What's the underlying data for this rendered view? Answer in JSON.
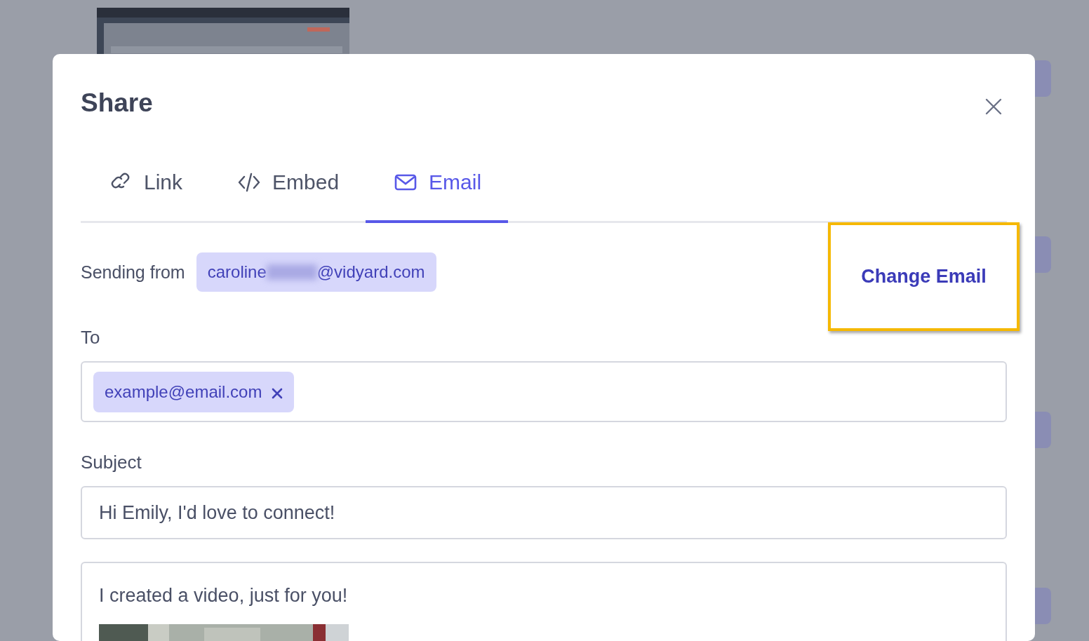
{
  "dialog": {
    "title": "Share"
  },
  "tabs": [
    {
      "label": "Link",
      "selected": false
    },
    {
      "label": "Embed",
      "selected": false
    },
    {
      "label": "Email",
      "selected": true
    }
  ],
  "sender": {
    "label": "Sending from",
    "email_start": "caroline",
    "email_redacted": true,
    "email_end": "@vidyard.com"
  },
  "change_email": {
    "label": "Change Email",
    "highlighted": true
  },
  "to": {
    "label": "To",
    "recipients": [
      {
        "email": "example@email.com"
      }
    ]
  },
  "subject": {
    "label": "Subject",
    "value": "Hi Emily, I'd love to connect!"
  },
  "message": {
    "text": "I created a video, just for you!"
  }
}
